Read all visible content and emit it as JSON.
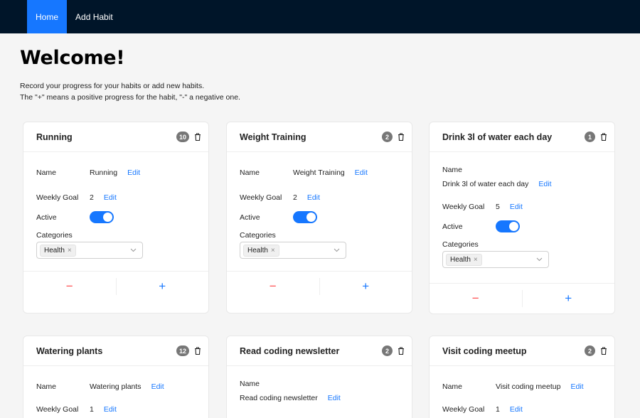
{
  "nav": {
    "home": "Home",
    "add_habit": "Add Habit"
  },
  "page": {
    "title": "Welcome!",
    "intro_line1": "Record your progress for your habits or add new habits.",
    "intro_line2": "The \"+\" means a positive progress for the habit, \"-\" a negative one."
  },
  "labels": {
    "name": "Name",
    "weekly_goal": "Weekly Goal",
    "active": "Active",
    "categories": "Categories",
    "edit": "Edit",
    "minus": "−",
    "plus": "+",
    "remove": "×"
  },
  "habits": [
    {
      "title": "Running",
      "count": "10",
      "name": "Running",
      "goal": "2",
      "category": "Health"
    },
    {
      "title": "Weight Training",
      "count": "2",
      "name": "Weight Training",
      "goal": "2",
      "category": "Health"
    },
    {
      "title": "Drink 3l of water each day",
      "count": "1",
      "name": "Drink 3l of water each day",
      "goal": "5",
      "category": "Health"
    },
    {
      "title": "Watering plants",
      "count": "12",
      "name": "Watering plants",
      "goal": "1"
    },
    {
      "title": "Read coding newsletter",
      "count": "2",
      "name": "Read coding newsletter"
    },
    {
      "title": "Visit coding meetup",
      "count": "2",
      "name": "Visit coding meetup",
      "goal": "1"
    }
  ],
  "colors": {
    "nav_bg": "#001529",
    "accent": "#1677ff",
    "danger": "#ff4d4f"
  },
  "icons": {
    "delete": "trash-icon",
    "dropdown": "chevron-down-icon"
  }
}
